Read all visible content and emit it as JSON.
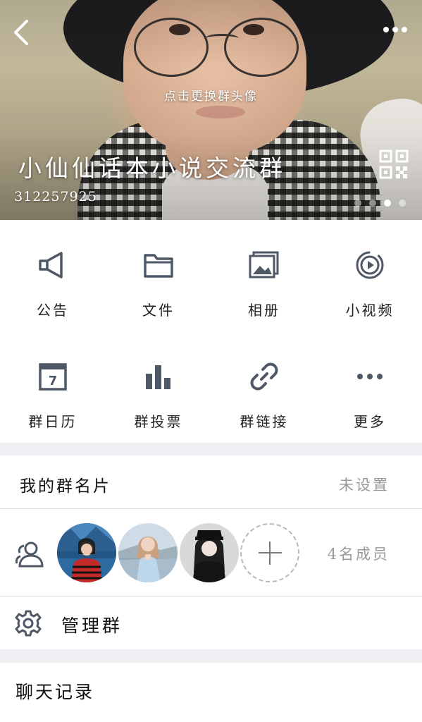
{
  "header": {
    "change_avatar_label": "点击更换群头像",
    "group_name": "小仙仙话本小说交流群",
    "group_id": "312257925",
    "page_count": 4,
    "active_page": 3
  },
  "features": [
    {
      "label": "公告",
      "icon": "megaphone-icon"
    },
    {
      "label": "文件",
      "icon": "folder-icon"
    },
    {
      "label": "相册",
      "icon": "album-icon"
    },
    {
      "label": "小视频",
      "icon": "video-icon"
    },
    {
      "label": "群日历",
      "icon": "calendar-icon",
      "calendar_day": "7"
    },
    {
      "label": "群投票",
      "icon": "bar-chart-icon"
    },
    {
      "label": "群链接",
      "icon": "link-icon"
    },
    {
      "label": "更多",
      "icon": "more-dots-icon"
    }
  ],
  "group_card": {
    "title": "我的群名片",
    "value": "未设置"
  },
  "members": {
    "count_label": "4名成员"
  },
  "manage": {
    "title": "管理群"
  },
  "history": {
    "title": "聊天记录"
  },
  "colors": {
    "icon_gray": "#4f5866",
    "divider": "#dedede",
    "background": "#efeff4"
  }
}
